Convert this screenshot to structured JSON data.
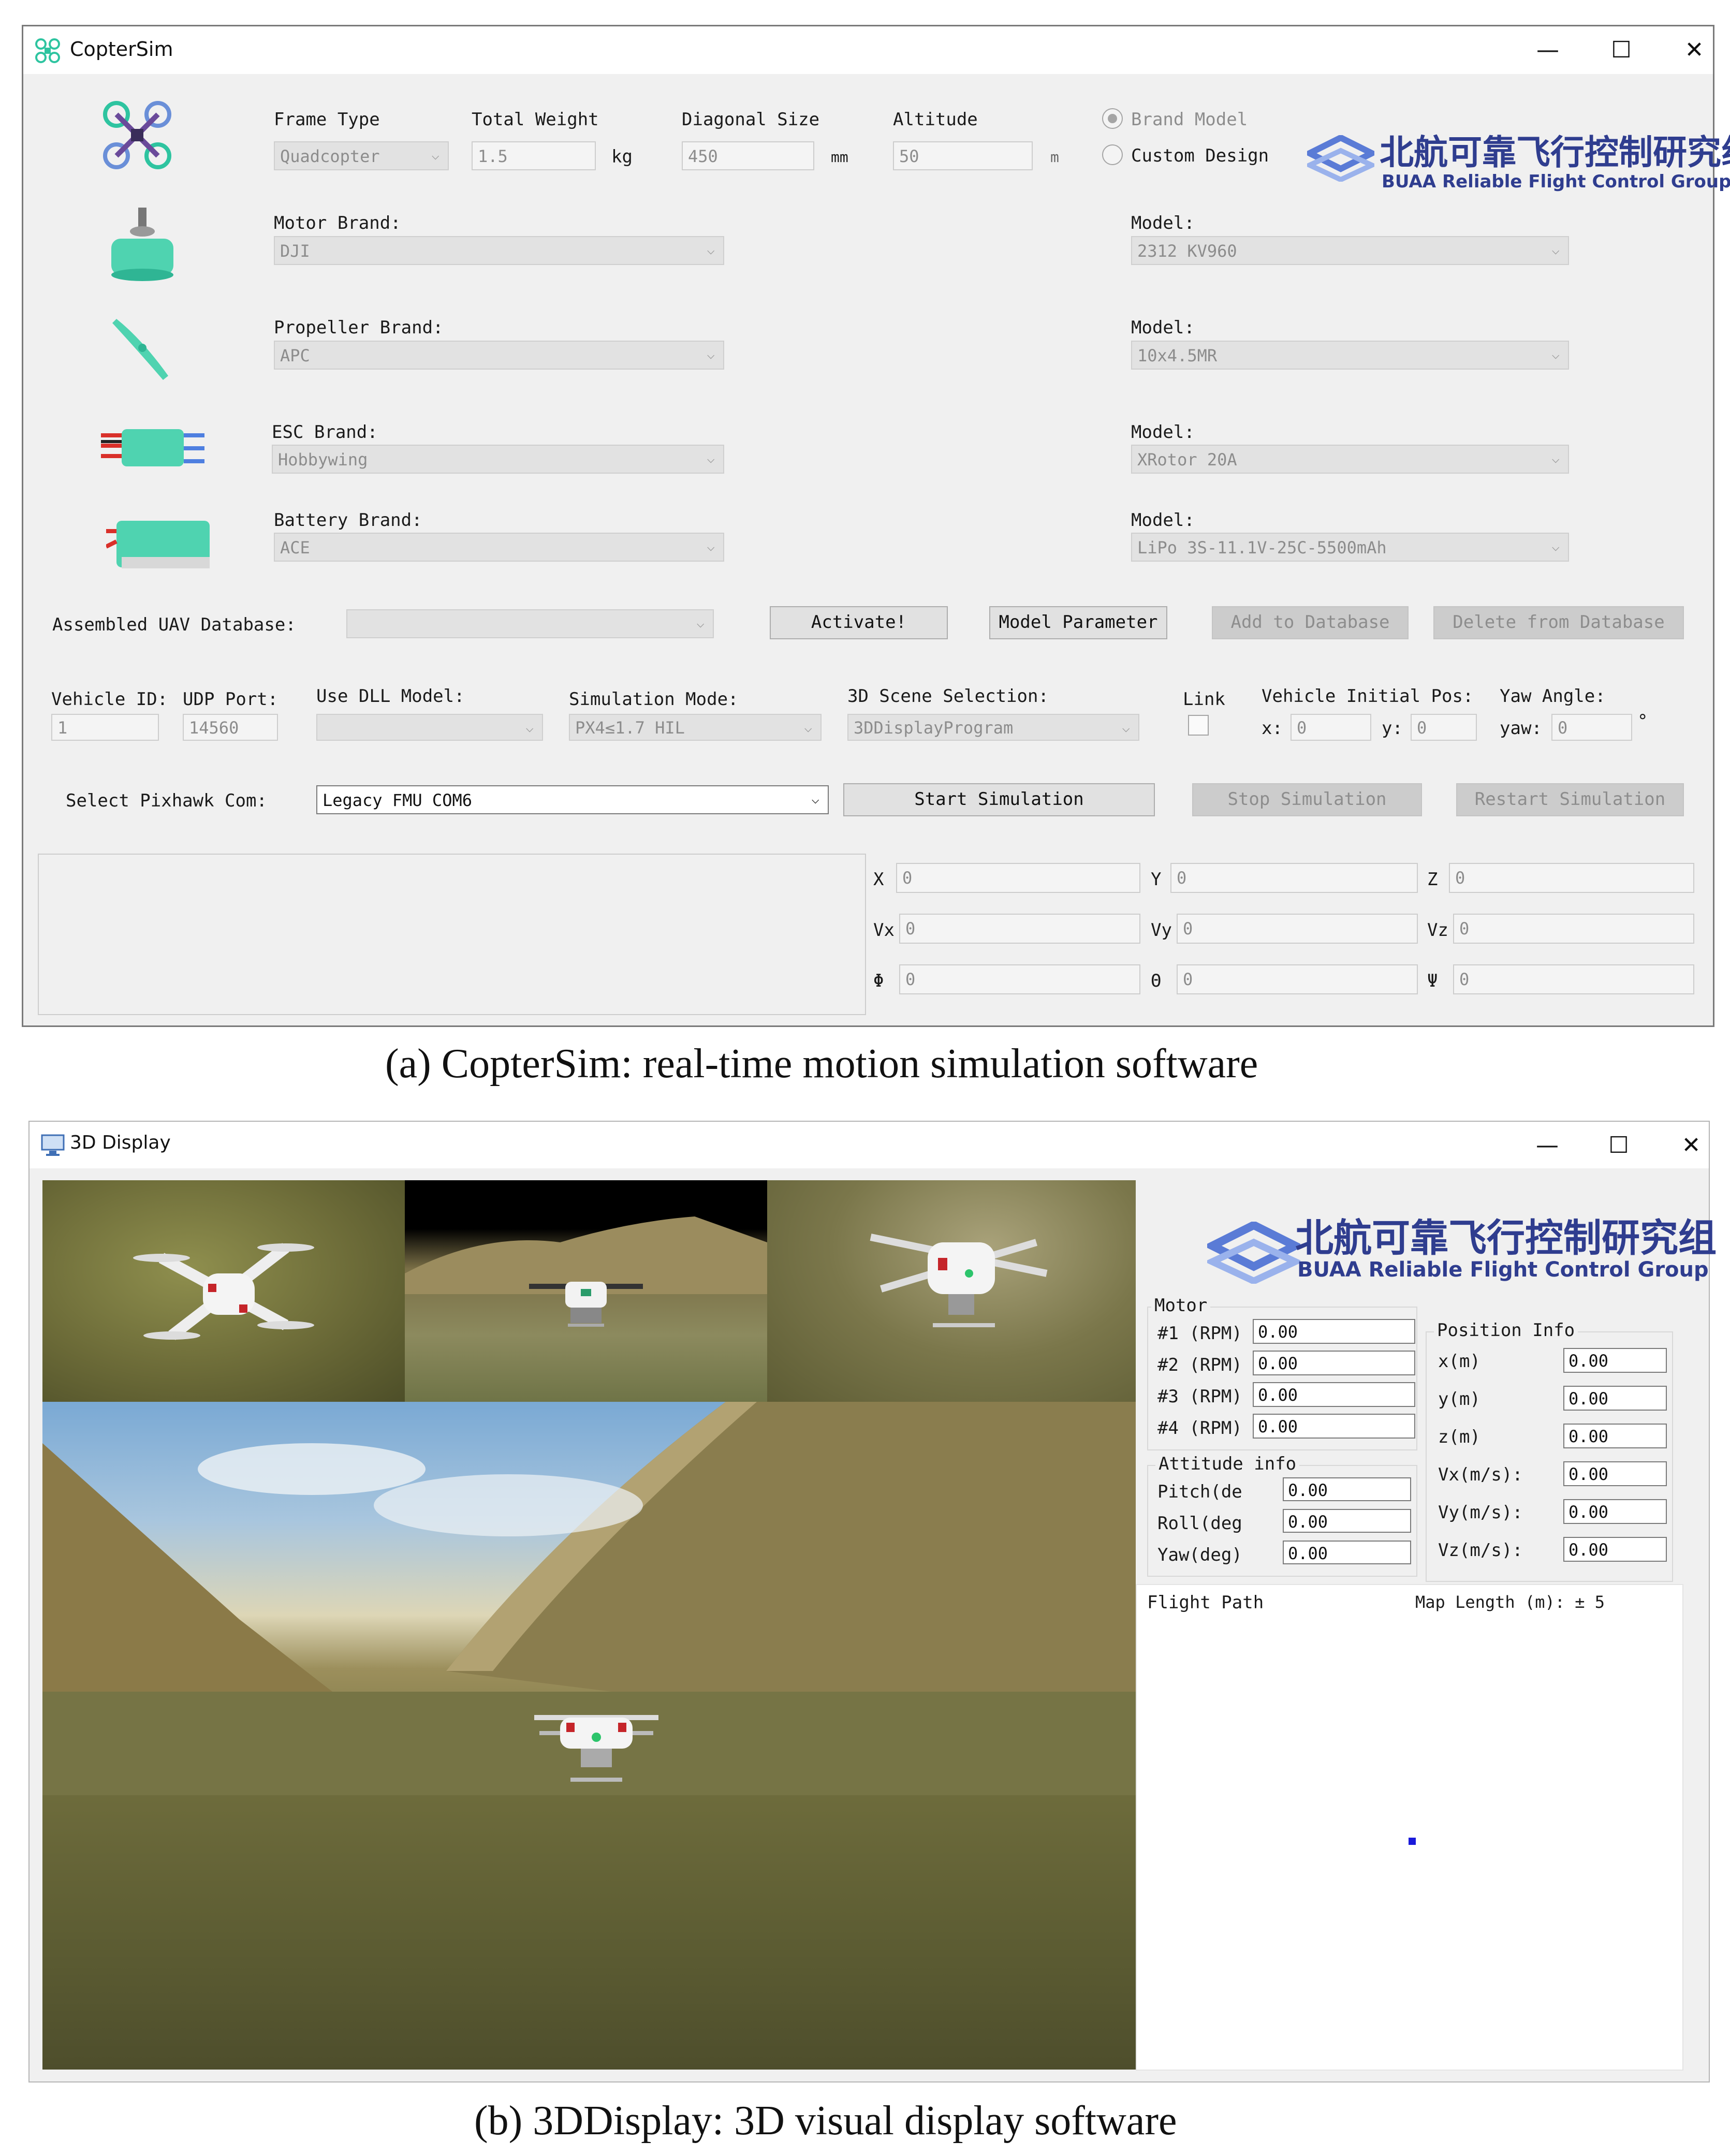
{
  "copter_window": {
    "title": "CopterSim",
    "controls": {
      "minimize": "—",
      "maximize": "☐",
      "close": "✕"
    },
    "logo": {
      "cn_text": "北航可靠飞行控制研究组",
      "en_text": "BUAA Reliable Flight Control Group"
    },
    "frame": {
      "frame_type_label": "Frame Type",
      "frame_type_value": "Quadcopter",
      "total_weight_label": "Total Weight",
      "total_weight_value": "1.5",
      "total_weight_unit": "kg",
      "diagonal_size_label": "Diagonal Size",
      "diagonal_size_value": "450",
      "diagonal_size_unit": "mm",
      "altitude_label": "Altitude",
      "altitude_value": "50",
      "altitude_unit": "m",
      "brand_model_label": "Brand Model",
      "custom_design_label": "Custom Design",
      "brand_model_selected": true
    },
    "components": [
      {
        "brand_label": "Motor Brand:",
        "brand_value": "DJI",
        "model_label": "Model:",
        "model_value": "2312 KV960",
        "icon": "motor-icon"
      },
      {
        "brand_label": "Propeller Brand:",
        "brand_value": "APC",
        "model_label": "Model:",
        "model_value": "10x4.5MR",
        "icon": "propeller-icon"
      },
      {
        "brand_label": "ESC Brand:",
        "brand_value": "Hobbywing",
        "model_label": "Model:",
        "model_value": "XRotor 20A",
        "icon": "esc-icon"
      },
      {
        "brand_label": "Battery Brand:",
        "brand_value": "ACE",
        "model_label": "Model:",
        "model_value": "LiPo 3S-11.1V-25C-5500mAh",
        "icon": "battery-icon"
      }
    ],
    "database": {
      "label": "Assembled UAV Database:",
      "value": "",
      "activate": "Activate!",
      "model_parameter": "Model Parameter",
      "add": "Add to Database",
      "delete": "Delete from Database"
    },
    "sim_config": {
      "vehicle_id_label": "Vehicle ID:",
      "vehicle_id_value": "1",
      "udp_port_label": "UDP Port:",
      "udp_port_value": "14560",
      "dll_label": "Use DLL Model:",
      "dll_value": "",
      "sim_mode_label": "Simulation Mode:",
      "sim_mode_value": "PX4≤1.7 HIL",
      "scene_label": "3D Scene Selection:",
      "scene_value": "3DDisplayProgram",
      "link_label": "Link",
      "init_pos_label": "Vehicle Initial Pos:",
      "x_label": "x:",
      "x_value": "0",
      "y_label": "y:",
      "y_value": "0",
      "yaw_angle_label": "Yaw Angle:",
      "yaw_label": "yaw:",
      "yaw_value": "0",
      "degree_symbol": "°"
    },
    "pixhawk": {
      "label": "Select Pixhawk Com:",
      "value": "Legacy FMU COM6",
      "start": "Start Simulation",
      "stop": "Stop Simulation",
      "restart": "Restart Simulation"
    },
    "state": [
      {
        "label": "X",
        "value": "0"
      },
      {
        "label": "Y",
        "value": "0"
      },
      {
        "label": "Z",
        "value": "0"
      },
      {
        "label": "Vx",
        "value": "0"
      },
      {
        "label": "Vy",
        "value": "0"
      },
      {
        "label": "Vz",
        "value": "0"
      },
      {
        "label": "Φ",
        "value": "0"
      },
      {
        "label": "Θ",
        "value": "0"
      },
      {
        "label": "Ψ",
        "value": "0"
      }
    ]
  },
  "caption_a": "(a) CopterSim: real-time motion simulation software",
  "display_window": {
    "title": "3D Display",
    "controls": {
      "minimize": "—",
      "maximize": "☐",
      "close": "✕"
    },
    "logo": {
      "cn_text": "北航可靠飞行控制研究组",
      "en_text": "BUAA Reliable Flight Control Group"
    },
    "motor": {
      "title": "Motor",
      "rows": [
        {
          "label": "#1 (RPM)",
          "value": "0.00"
        },
        {
          "label": "#2 (RPM)",
          "value": "0.00"
        },
        {
          "label": "#3 (RPM)",
          "value": "0.00"
        },
        {
          "label": "#4 (RPM)",
          "value": "0.00"
        }
      ]
    },
    "attitude": {
      "title": "Attitude info",
      "rows": [
        {
          "label": "Pitch(de",
          "value": "0.00"
        },
        {
          "label": "Roll(deg",
          "value": "0.00"
        },
        {
          "label": "Yaw(deg)",
          "value": "0.00"
        }
      ]
    },
    "position": {
      "title": "Position Info",
      "rows": [
        {
          "label": "x(m)",
          "value": "0.00"
        },
        {
          "label": "y(m)",
          "value": "0.00"
        },
        {
          "label": "z(m)",
          "value": "0.00"
        },
        {
          "label": "Vx(m/s):",
          "value": "0.00"
        },
        {
          "label": "Vy(m/s):",
          "value": "0.00"
        },
        {
          "label": "Vz(m/s):",
          "value": "0.00"
        }
      ]
    },
    "flight_path": {
      "title": "Flight Path",
      "map_length": "Map Length (m): ± 5"
    }
  },
  "caption_b": "(b) 3DDisplay: 3D visual display software"
}
